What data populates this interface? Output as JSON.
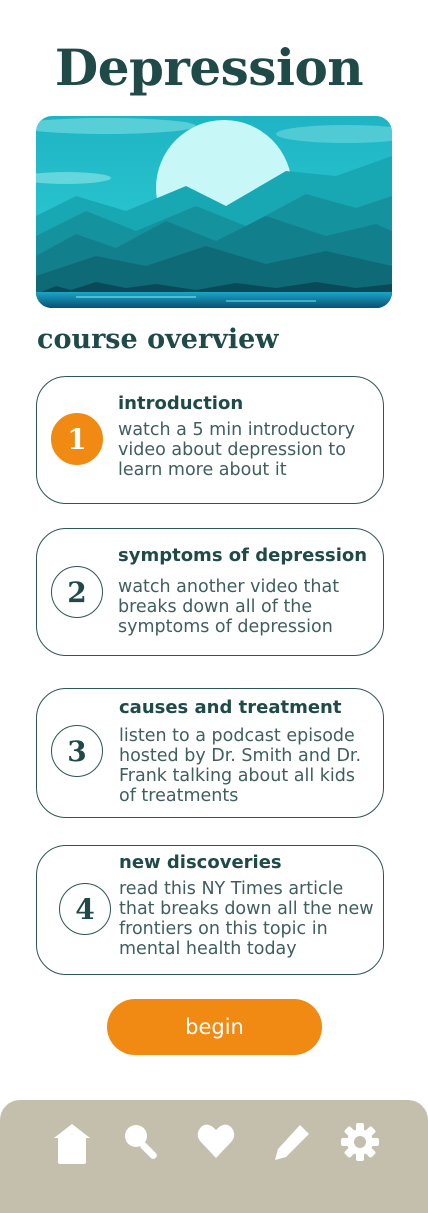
{
  "page": {
    "title": "Depression",
    "section_title": "course overview"
  },
  "hero": {
    "icon": "mountain-lake-landscape"
  },
  "course": {
    "items": [
      {
        "number": "1",
        "title": "introduction",
        "description": "watch a 5 min introductory video about depression to learn more about it",
        "active": true
      },
      {
        "number": "2",
        "title": "symptoms of depression",
        "description": "watch another video that breaks down all of the symptoms of depression",
        "active": false
      },
      {
        "number": "3",
        "title": "causes and treatment",
        "description": "listen to a podcast episode hosted by Dr. Smith and Dr. Frank talking about all kids of treatments",
        "active": false
      },
      {
        "number": "4",
        "title": "new discoveries",
        "description": "read this NY Times article that breaks down all the new frontiers on this topic in mental health today",
        "active": false
      }
    ]
  },
  "actions": {
    "begin_label": "begin"
  },
  "nav": {
    "items": [
      {
        "icon": "home-icon"
      },
      {
        "icon": "search-icon"
      },
      {
        "icon": "heart-icon"
      },
      {
        "icon": "pencil-icon"
      },
      {
        "icon": "gear-icon"
      }
    ]
  },
  "colors": {
    "accent": "#f18a12",
    "primary_text": "#1f4a48",
    "navbar": "#c4bfac"
  }
}
